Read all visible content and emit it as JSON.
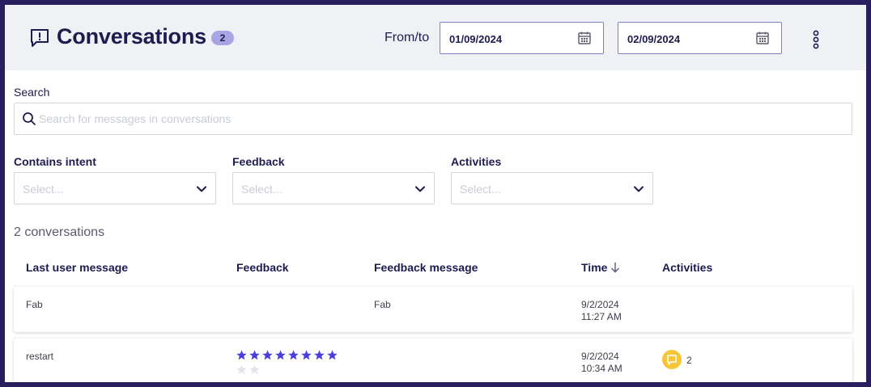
{
  "header": {
    "title": "Conversations",
    "count_badge": "2",
    "fromto_label": "From/to",
    "date_from": "01/09/2024",
    "date_to": "02/09/2024"
  },
  "search": {
    "label": "Search",
    "placeholder": "Search for messages in conversations"
  },
  "filters": [
    {
      "label": "Contains intent",
      "placeholder": "Select..."
    },
    {
      "label": "Feedback",
      "placeholder": "Select..."
    },
    {
      "label": "Activities",
      "placeholder": "Select..."
    }
  ],
  "conversations_count_text": "2 conversations",
  "table": {
    "columns": [
      "Last user message",
      "Feedback",
      "Feedback message",
      "Time",
      "Activities"
    ],
    "rows": [
      {
        "last_user_message": "Fab",
        "feedback_stars": null,
        "feedback_message": "Fab",
        "time_date": "9/2/2024",
        "time_clock": "11:27 AM",
        "activities_count": null
      },
      {
        "last_user_message": "restart",
        "feedback_stars": {
          "filled": 8,
          "total": 10
        },
        "feedback_message": "",
        "time_date": "9/2/2024",
        "time_clock": "10:34 AM",
        "activities_count": "2"
      }
    ]
  },
  "colors": {
    "accent": "#4b3fe0",
    "badge": "#a7a5e4",
    "activity": "#f5c53a",
    "frame": "#2a1f5e"
  }
}
